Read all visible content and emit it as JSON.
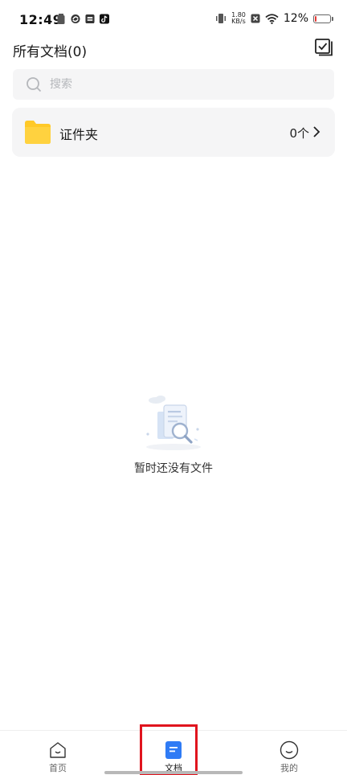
{
  "status_bar": {
    "time": "12:49",
    "net_speed_value": "1.80",
    "net_speed_unit": "KB/s",
    "battery_percent": "12%",
    "battery_level": 0.12,
    "battery_color": "#e53935"
  },
  "header": {
    "title": "所有文档(0)",
    "select_icon": "checkbox-multi-icon"
  },
  "search": {
    "placeholder": "搜索",
    "value": ""
  },
  "folders": [
    {
      "name": "证件夹",
      "count": "0个",
      "icon": "folder-icon",
      "color": "#ffc928"
    }
  ],
  "empty_state": {
    "message": "暂时还没有文件"
  },
  "bottom_nav": {
    "items": [
      {
        "label": "首页",
        "icon": "home-icon",
        "active": false
      },
      {
        "label": "文档",
        "icon": "document-icon",
        "active": true
      },
      {
        "label": "我的",
        "icon": "profile-icon",
        "active": false
      }
    ],
    "active_color": "#2f7bf5"
  }
}
